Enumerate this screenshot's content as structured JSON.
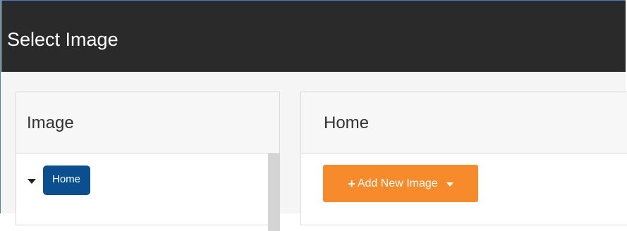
{
  "dialog": {
    "title": "Select Image"
  },
  "left_panel": {
    "heading": "Image",
    "tree": {
      "nodes": [
        {
          "label": "Home",
          "expanded": true,
          "selected": true
        }
      ]
    }
  },
  "right_panel": {
    "heading": "Home",
    "add_button": {
      "icon": "plus-icon",
      "label": "Add New Image",
      "has_dropdown": true
    }
  },
  "colors": {
    "titlebar_bg": "#2a2a2a",
    "node_badge_bg": "#0b4f91",
    "add_button_bg": "#f78b2b",
    "frame_border": "#4a7bbf"
  }
}
